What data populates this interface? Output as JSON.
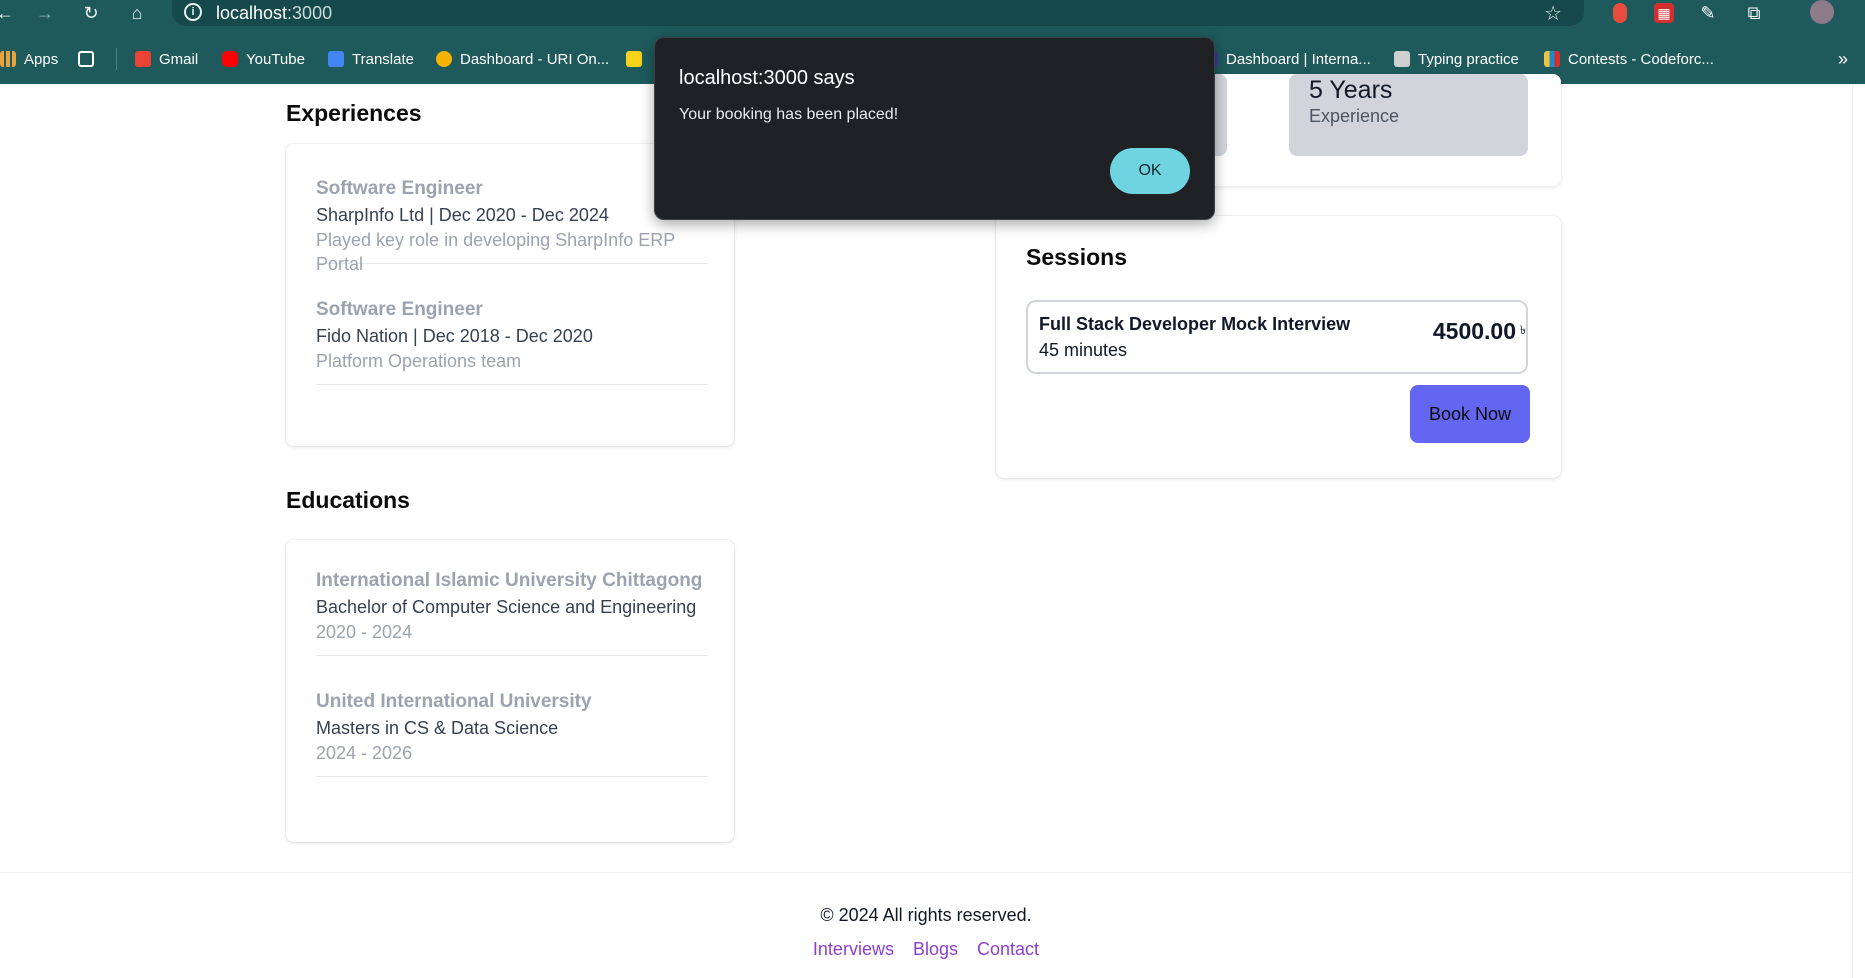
{
  "browser": {
    "url_host": "localhost",
    "url_port": ":3000",
    "bookmarks": [
      {
        "label": "Apps",
        "icon": "apps-grid-icon",
        "color": "#e8a33c"
      },
      {
        "label": "",
        "icon": "tab-groups-icon",
        "color": "#ffffff"
      },
      {
        "label": "Gmail",
        "icon": "gmail-icon",
        "color": "#ea4335"
      },
      {
        "label": "YouTube",
        "icon": "youtube-icon",
        "color": "#ff0000"
      },
      {
        "label": "Translate",
        "icon": "translate-icon",
        "color": "#4285f4"
      },
      {
        "label": "Dashboard - URI On...",
        "icon": "uri-icon",
        "color": "#f4b400"
      },
      {
        "label": "",
        "icon": "pencil-bookmark-icon",
        "color": "#f7d21a"
      },
      {
        "label": "Dashboard | Interna...",
        "icon": "dashboard-icon",
        "color": "#3b3b98"
      },
      {
        "label": "Typing practice",
        "icon": "typing-icon",
        "color": "#cfcfcf"
      },
      {
        "label": "Contests - Codeforc...",
        "icon": "codeforces-icon",
        "color": "#1f8acb"
      }
    ]
  },
  "experiences": {
    "title": "Experiences",
    "items": [
      {
        "role": "Software Engineer",
        "company": "SharpInfo Ltd | Dec 2020 - Dec 2024",
        "desc": "Played key role in developing SharpInfo ERP Portal"
      },
      {
        "role": "Software Engineer",
        "company": "Fido Nation | Dec 2018 - Dec 2020",
        "desc": "Platform Operations team"
      }
    ]
  },
  "educations": {
    "title": "Educations",
    "items": [
      {
        "school": "International Islamic University Chittagong",
        "degree": "Bachelor of Computer Science and Engineering",
        "years": "2020 - 2024"
      },
      {
        "school": "United International University",
        "degree": "Masters in CS & Data Science",
        "years": "2024 - 2026"
      }
    ]
  },
  "stats": {
    "experience_value": "5 Years",
    "experience_label": "Experience"
  },
  "sessions": {
    "title": "Sessions",
    "item_name": "Full Stack Developer Mock Interview",
    "item_duration": "45 minutes",
    "item_price": "4500.00",
    "item_currency": "৳",
    "book_label": "Book Now",
    "book_color": "#6366f1"
  },
  "footer": {
    "copyright": "© 2024 All rights reserved.",
    "links": [
      "Interviews",
      "Blogs",
      "Contact"
    ],
    "link_color": "#8b3fd1"
  },
  "dialog": {
    "title": "localhost:3000 says",
    "message": "Your booking has been placed!",
    "ok_label": "OK",
    "ok_color": "#6fd3e0"
  }
}
